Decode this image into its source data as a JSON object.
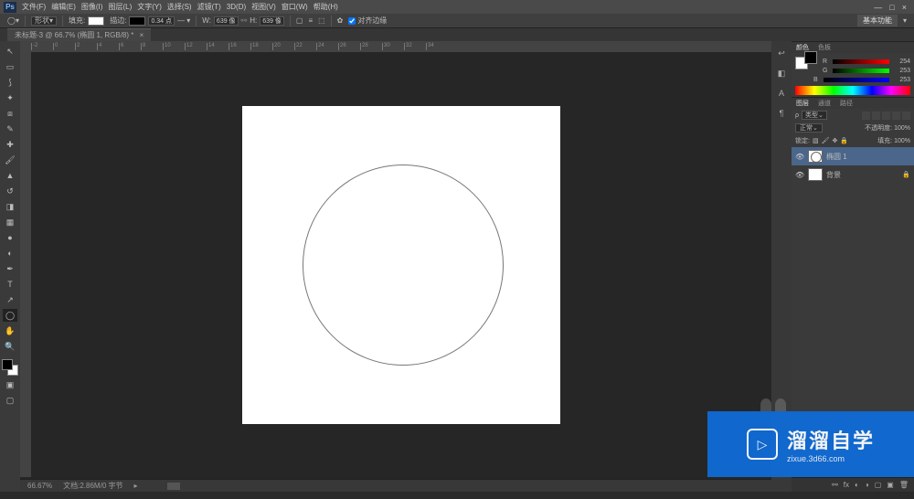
{
  "menu": {
    "items": [
      "文件(F)",
      "编辑(E)",
      "图像(I)",
      "图层(L)",
      "文字(Y)",
      "选择(S)",
      "滤镜(T)",
      "3D(D)",
      "视图(V)",
      "窗口(W)",
      "帮助(H)"
    ]
  },
  "options": {
    "shape_mode": "形状",
    "fill_label": "填充:",
    "stroke_label": "描边:",
    "stroke_width": "0.34 点",
    "w_label": "W:",
    "w_value": "639 像",
    "h_label": "H:",
    "h_value": "639 像",
    "align_label": "对齐边缘",
    "workspace": "基本功能"
  },
  "document": {
    "tab": "未标题-3 @ 66.7% (椭圆 1, RGB/8) *"
  },
  "status": {
    "zoom": "66.67%",
    "info": "文档:2.86M/0 字节"
  },
  "color_panel": {
    "tabs": [
      "颜色",
      "色板"
    ],
    "r": 254,
    "g": 253,
    "b": 253
  },
  "layers_panel": {
    "tabs": [
      "图层",
      "通道",
      "路径"
    ],
    "kind_label": "类型",
    "blend_mode": "正常",
    "opacity_label": "不透明度:",
    "opacity_value": "100%",
    "lock_label": "锁定:",
    "fill_label": "填充:",
    "fill_value": "100%",
    "layers": [
      {
        "name": "椭圆 1",
        "selected": true,
        "locked": false
      },
      {
        "name": "背景",
        "selected": false,
        "locked": true
      }
    ]
  },
  "ruler_ticks": [
    "-2",
    "0",
    "2",
    "4",
    "6",
    "8",
    "10",
    "12",
    "14",
    "16",
    "18",
    "20",
    "22",
    "24",
    "26",
    "28",
    "30",
    "32",
    "34"
  ],
  "watermark": {
    "cn": "溜溜自学",
    "en": "zixue.3d66.com"
  }
}
